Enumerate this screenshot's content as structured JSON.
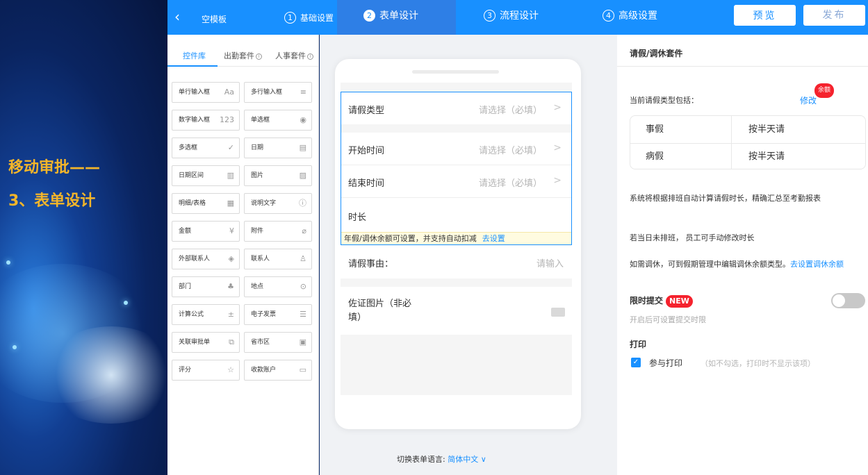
{
  "slide": {
    "title_line1": "移动审批——",
    "title_line2": "3、表单设计"
  },
  "topbar": {
    "back_icon": "‹",
    "template_name": "空模板",
    "steps": [
      {
        "num": "1",
        "label": "基础设置"
      },
      {
        "num": "2",
        "label": "表单设计"
      },
      {
        "num": "3",
        "label": "流程设计"
      },
      {
        "num": "4",
        "label": "高级设置"
      }
    ],
    "preview_label": "预览",
    "publish_label": "发布"
  },
  "left_panel": {
    "tabs": [
      "控件库",
      "出勤套件",
      "人事套件"
    ],
    "controls": [
      {
        "label": "单行输入框",
        "icon": "Aa"
      },
      {
        "label": "多行输入框",
        "icon": "≡"
      },
      {
        "label": "数字输入框",
        "icon": "123"
      },
      {
        "label": "单选框",
        "icon": "◉"
      },
      {
        "label": "多选框",
        "icon": "✓"
      },
      {
        "label": "日期",
        "icon": "▤"
      },
      {
        "label": "日期区间",
        "icon": "▥"
      },
      {
        "label": "图片",
        "icon": "▨"
      },
      {
        "label": "明细/表格",
        "icon": "▦"
      },
      {
        "label": "说明文字",
        "icon": "ⓘ"
      },
      {
        "label": "金额",
        "icon": "¥"
      },
      {
        "label": "附件",
        "icon": "⌀"
      },
      {
        "label": "外部联系人",
        "icon": "◈"
      },
      {
        "label": "联系人",
        "icon": "♙"
      },
      {
        "label": "部门",
        "icon": "♣"
      },
      {
        "label": "地点",
        "icon": "⊙"
      },
      {
        "label": "计算公式",
        "icon": "±"
      },
      {
        "label": "电子发票",
        "icon": "☰"
      },
      {
        "label": "关联审批单",
        "icon": "⧉"
      },
      {
        "label": "省市区",
        "icon": "▣"
      },
      {
        "label": "评分",
        "icon": "☆"
      },
      {
        "label": "收款账户",
        "icon": "▭"
      }
    ]
  },
  "form": {
    "fields": [
      {
        "label": "请假类型",
        "placeholder": "请选择（必填）"
      },
      {
        "label": "开始时间",
        "placeholder": "请选择（必填）"
      },
      {
        "label": "结束时间",
        "placeholder": "请选择（必填）"
      },
      {
        "label": "时长",
        "placeholder": ""
      }
    ],
    "tip_text": "年假/调休余额可设置，并支持自动扣减",
    "tip_link": "去设置",
    "reason_label": "请假事由：",
    "reason_placeholder": "请输入",
    "photo_label_line1": "佐证图片（非必",
    "photo_label_line2": "填）",
    "arrow_icon": ">",
    "lang_label": "切换表单语言:",
    "lang_value": "简体中文 ∨"
  },
  "right_panel": {
    "title": "请假/调休套件",
    "current_label": "当前请假类型包括：",
    "modify_label": "修改",
    "badge": "余额",
    "leave_types": [
      {
        "name": "事假",
        "unit": "按半天请"
      },
      {
        "name": "病假",
        "unit": "按半天请"
      }
    ],
    "desc1": "系统将根据排班自动计算请假时长，精确汇总至考勤报表",
    "desc2": "若当日未排班， 员工可手动修改时长",
    "desc3_text": "如需调休，可到假期管理中编辑调休余额类型。",
    "desc3_link": "去设置调休余额",
    "limit_label": "限时提交",
    "new_badge": "NEW",
    "limit_sub": "开启后可设置提交时限",
    "print_label": "打印",
    "print_check_label": "参与打印",
    "print_note": "（如不勾选，打印时不显示该项）",
    "checkbox_checked": true,
    "toggle_on": false
  },
  "colors": {
    "accent": "#1890ff",
    "title_gold": "#f3b52a",
    "badge_red": "#f5222d"
  }
}
